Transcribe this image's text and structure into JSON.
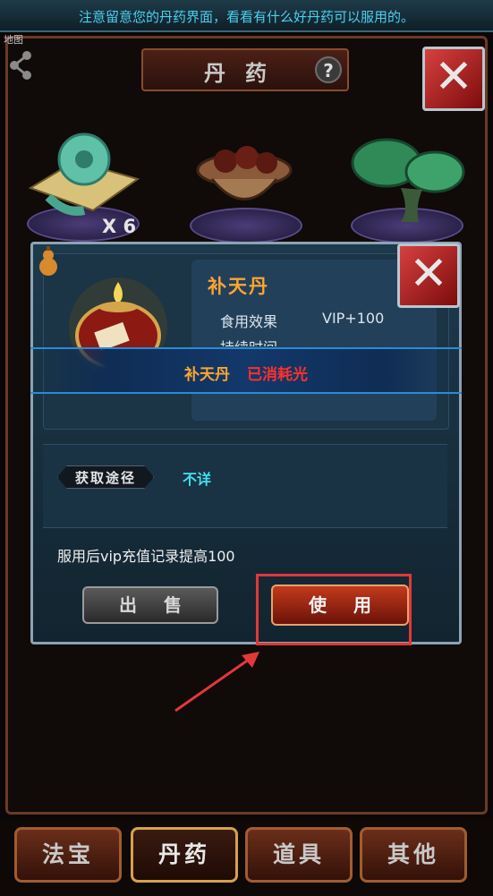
{
  "notice": "注意留意您的丹药界面，看看有什么好丹药可以服用的。",
  "map_label": "地图",
  "title": "丹药",
  "help_symbol": "?",
  "close_symbol": "✕",
  "shelf": {
    "items": [
      {
        "icon": "jade-pendant-icon",
        "quantity": "X 6"
      },
      {
        "icon": "pill-bowl-icon",
        "quantity": ""
      },
      {
        "icon": "lingzhi-mushroom-icon",
        "quantity": ""
      }
    ]
  },
  "dialog": {
    "item_name": "补天丹",
    "effect_label": "食用效果",
    "effect_value": "VIP+100",
    "duration_label": "持续时间",
    "source_label": "获取途径",
    "source_value": "不详",
    "description": "服用后vip充值记录提高100",
    "sell_label": "出售",
    "use_label": "使用"
  },
  "toast": {
    "item_name": "补天丹",
    "status": "已消耗光"
  },
  "tabs": [
    {
      "label": "法宝",
      "active": false
    },
    {
      "label": "丹药",
      "active": true
    },
    {
      "label": "道具",
      "active": false
    },
    {
      "label": "其他",
      "active": false
    }
  ],
  "colors": {
    "item_name": "#ffa431",
    "status_red": "#ff2f2f",
    "source_cyan": "#3fe0ee",
    "highlight": "#e23838"
  }
}
